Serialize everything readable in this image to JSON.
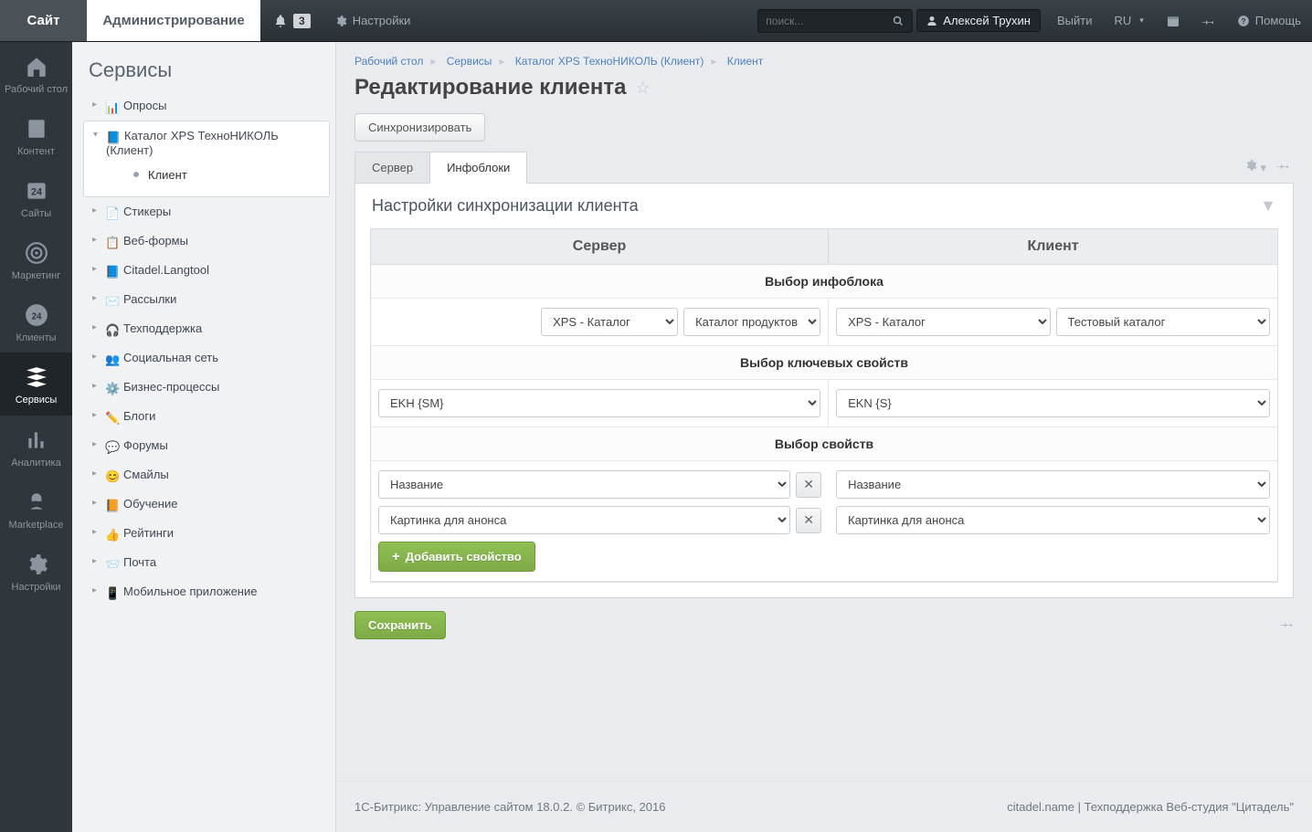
{
  "topbar": {
    "site": "Сайт",
    "admin": "Администрирование",
    "notif_count": "3",
    "settings": "Настройки",
    "search_placeholder": "поиск...",
    "user": "Алексей Трухин",
    "logout": "Выйти",
    "lang": "RU",
    "help": "Помощь"
  },
  "rail": [
    {
      "label": "Рабочий стол"
    },
    {
      "label": "Контент"
    },
    {
      "label": "Сайты"
    },
    {
      "label": "Маркетинг"
    },
    {
      "label": "Клиенты"
    },
    {
      "label": "Сервисы"
    },
    {
      "label": "Аналитика"
    },
    {
      "label": "Marketplace"
    },
    {
      "label": "Настройки"
    }
  ],
  "sidebar": {
    "title": "Сервисы",
    "items": [
      {
        "label": "Опросы"
      },
      {
        "label": "Каталог XPS ТехноНИКОЛЬ (Клиент)",
        "children": [
          {
            "label": "Клиент"
          }
        ]
      },
      {
        "label": "Стикеры"
      },
      {
        "label": "Веб-формы"
      },
      {
        "label": "Citadel.Langtool"
      },
      {
        "label": "Рассылки"
      },
      {
        "label": "Техподдержка"
      },
      {
        "label": "Социальная сеть"
      },
      {
        "label": "Бизнес-процессы"
      },
      {
        "label": "Блоги"
      },
      {
        "label": "Форумы"
      },
      {
        "label": "Смайлы"
      },
      {
        "label": "Обучение"
      },
      {
        "label": "Рейтинги"
      },
      {
        "label": "Почта"
      },
      {
        "label": "Мобильное приложение"
      }
    ]
  },
  "crumbs": {
    "c0": "Рабочий стол",
    "c1": "Сервисы",
    "c2": "Каталог XPS ТехноНИКОЛЬ (Клиент)",
    "c3": "Клиент"
  },
  "page": {
    "title": "Редактирование клиента",
    "sync_btn": "Синхронизировать",
    "tabs": {
      "server": "Сервер",
      "infoblocks": "Инфоблоки"
    },
    "panel_title": "Настройки синхронизации клиента"
  },
  "table": {
    "th_server": "Сервер",
    "th_client": "Клиент",
    "sec_block": "Выбор инфоблока",
    "sec_keys": "Выбор ключевых свойств",
    "sec_props": "Выбор свойств",
    "server": {
      "block_type": "XPS - Каталог",
      "block": "Каталог продуктов",
      "key": "EKH {SM}",
      "prop1": "Название",
      "prop2": "Картинка для анонса"
    },
    "client": {
      "block_type": "XPS - Каталог",
      "block": "Тестовый каталог",
      "key": "EKN {S}",
      "prop1": "Название",
      "prop2": "Картинка для анонса"
    },
    "add_prop": "Добавить свойство",
    "save": "Сохранить"
  },
  "footer": {
    "left": "1С-Битрикс: Управление сайтом 18.0.2. © Битрикс, 2016",
    "link1": "citadel.name",
    "sep": " | ",
    "link2": "Техподдержка Веб-студия \"Цитадель\""
  }
}
